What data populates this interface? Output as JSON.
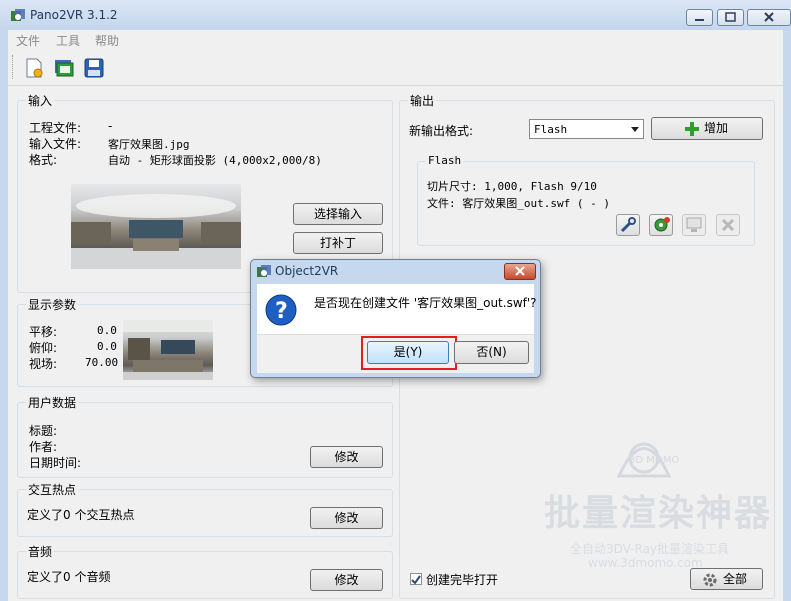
{
  "window": {
    "title": "Pano2VR 3.1.2"
  },
  "menu": [
    "文件",
    "工具",
    "帮助"
  ],
  "toolbar": {
    "icons": [
      "new-project-icon",
      "open-project-icon",
      "save-icon"
    ]
  },
  "input": {
    "title": "输入",
    "project_label": "工程文件:",
    "project_value": "-",
    "file_label": "输入文件:",
    "file_value": "客厅效果图.jpg",
    "format_label": "格式:",
    "format_value": "自动 - 矩形球面投影 (4,000x2,000/8)",
    "select_button": "选择输入",
    "patch_button": "打补丁"
  },
  "display": {
    "title": "显示参数",
    "pan_label": "平移:",
    "pan_value": "0.0",
    "tilt_label": "俯仰:",
    "tilt_value": "0.0",
    "fov_label": "视场:",
    "fov_value": "70.00"
  },
  "user_data": {
    "title": "用户数据",
    "title_label": "标题:",
    "author_label": "作者:",
    "datetime_label": "日期时间:",
    "edit_button": "修改"
  },
  "hotspots": {
    "title": "交互热点",
    "text": "定义了0 个交互热点",
    "edit_button": "修改"
  },
  "audio": {
    "title": "音频",
    "text": "定义了0 个音频",
    "edit_button": "修改"
  },
  "output": {
    "title": "输出",
    "new_format_label": "新输出格式:",
    "format_selected": "Flash",
    "add_button": "增加",
    "flash": {
      "title": "Flash",
      "tile_size": "切片尺寸: 1,000, Flash 9/10",
      "file": "文件: 客厅效果图_out.swf ( - )"
    },
    "open_checkbox_label": "创建完毕打开",
    "open_checkbox_checked": true,
    "all_button": "全部"
  },
  "watermark": {
    "logo": "3D MOMO",
    "title": "批量渲染神器",
    "line1": "全自动3DV-Ray批量渲染工具",
    "line2": "www.3dmomo.com"
  },
  "dialog": {
    "title": "Object2VR",
    "message": "是否现在创建文件 '客厅效果图_out.swf'?",
    "yes_button": "是(Y)",
    "no_button": "否(N)",
    "highlight_color": "#e02020"
  }
}
